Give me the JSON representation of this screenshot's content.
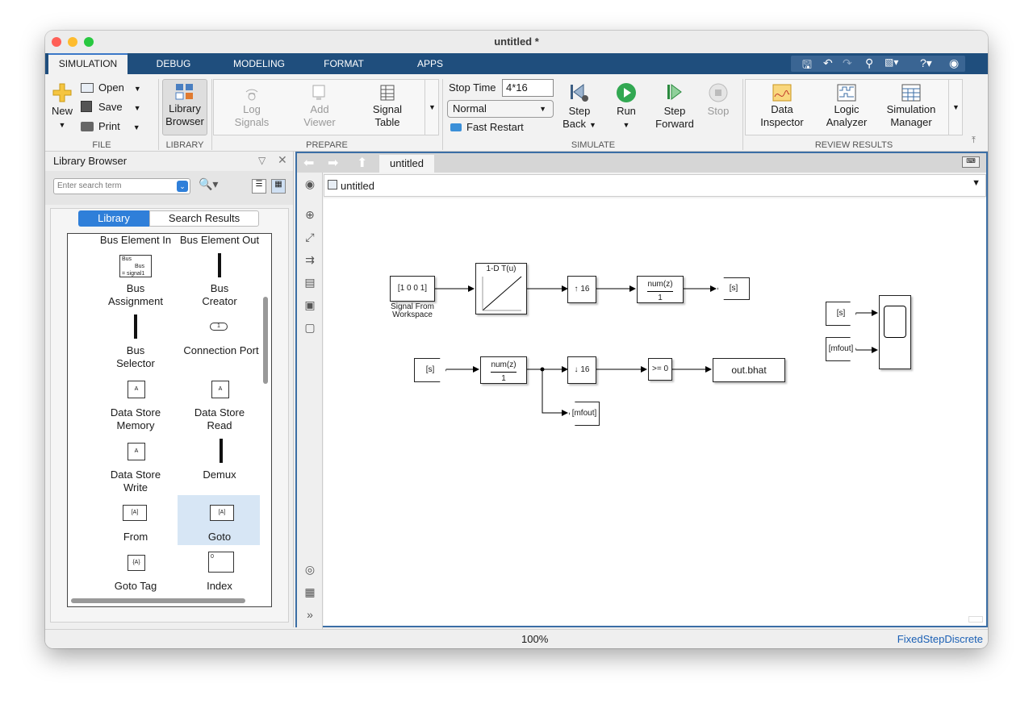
{
  "window": {
    "title": "untitled *"
  },
  "tabs": [
    "SIMULATION",
    "DEBUG",
    "MODELING",
    "FORMAT",
    "APPS"
  ],
  "ribbon": {
    "file": {
      "new": "New",
      "open": "Open",
      "save": "Save",
      "print": "Print",
      "label": "FILE"
    },
    "library": {
      "browser_l1": "Library",
      "browser_l2": "Browser",
      "label": "LIBRARY"
    },
    "prepare": {
      "log1": "Log",
      "log2": "Signals",
      "add1": "Add",
      "add2": "Viewer",
      "sig1": "Signal",
      "sig2": "Table",
      "label": "PREPARE"
    },
    "simulate": {
      "stop_time_label": "Stop Time",
      "stop_time_value": "4*16",
      "mode": "Normal",
      "fast_restart": "Fast Restart",
      "step_back1": "Step",
      "step_back2": "Back",
      "run": "Run",
      "step_fwd1": "Step",
      "step_fwd2": "Forward",
      "stop": "Stop",
      "label": "SIMULATE"
    },
    "review": {
      "di1": "Data",
      "di2": "Inspector",
      "la1": "Logic",
      "la2": "Analyzer",
      "sm1": "Simulation",
      "sm2": "Manager",
      "label": "REVIEW RESULTS"
    }
  },
  "library_browser": {
    "title": "Library Browser",
    "search_placeholder": "Enter search term",
    "tab_library": "Library",
    "tab_search": "Search Results",
    "header_left": "Bus Element In",
    "header_right": "Bus Element Out",
    "items": [
      {
        "l1": "Bus",
        "l2": "Assignment"
      },
      {
        "l1": "Bus",
        "l2": "Creator"
      },
      {
        "l1": "Bus",
        "l2": "Selector"
      },
      {
        "l1": "Connection Port",
        "l2": ""
      },
      {
        "l1": "Data Store",
        "l2": "Memory"
      },
      {
        "l1": "Data Store",
        "l2": "Read"
      },
      {
        "l1": "Data Store",
        "l2": "Write"
      },
      {
        "l1": "Demux",
        "l2": ""
      },
      {
        "l1": "From",
        "l2": ""
      },
      {
        "l1": "Goto",
        "l2": ""
      },
      {
        "l1": "Goto Tag",
        "l2": ""
      },
      {
        "l1": "Index",
        "l2": ""
      }
    ],
    "icon_text": {
      "bus": "Bus",
      "signal1": "= signal1",
      "one": "1",
      "A": "A",
      "fromA": "[A]",
      "gotoA": "[A]",
      "tagA": "{A}",
      "zero": "0"
    }
  },
  "canvas": {
    "tab": "untitled",
    "breadcrumb": "untitled",
    "blocks": {
      "sfw_value": "[1 0 0 1]",
      "sfw_label1": "Signal From",
      "sfw_label2": "Workspace",
      "lookup": "1-D T(u)",
      "up16": "16",
      "num1": "num(z)",
      "den1": "1",
      "goto_s": "[s]",
      "from_s": "[s]",
      "num2": "num(z)",
      "den2": "1",
      "down16": "16",
      "cmp": ">= 0",
      "out": "out.bhat",
      "goto_mfout": "[mfout]",
      "from_s2": "[s]",
      "from_mfout": "[mfout]"
    }
  },
  "status": {
    "zoom": "100%",
    "solver": "FixedStepDiscrete"
  }
}
